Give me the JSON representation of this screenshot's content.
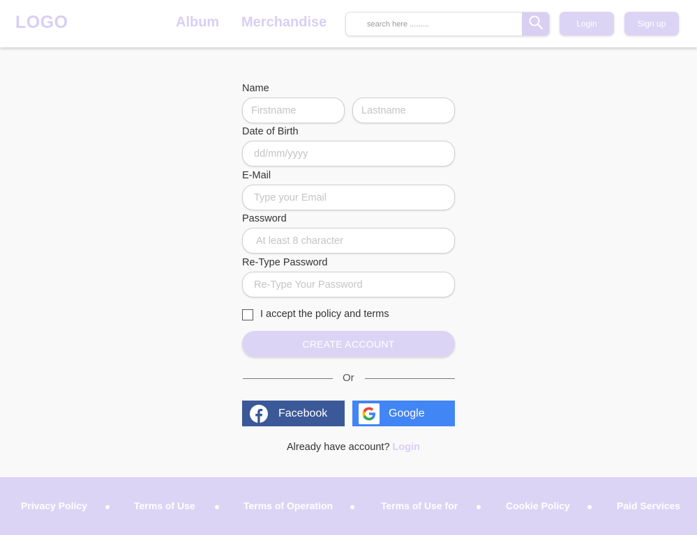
{
  "header": {
    "logo": "LOGO",
    "nav": [
      "Album",
      "Merchandise"
    ],
    "search_placeholder": "search here .........",
    "login_label": "Login",
    "signup_label": "Sign up"
  },
  "form": {
    "name_label": "Name",
    "firstname_placeholder": "Firstname",
    "lastname_placeholder": "Lastname",
    "dob_label": "Date of Birth",
    "dob_placeholder": "dd/mm/yyyy",
    "email_label": "E-Mail",
    "email_placeholder": "Type your Email",
    "password_label": "Password",
    "password_placeholder": "At least 8 character",
    "retype_label": "Re-Type Password",
    "retype_placeholder": "Re-Type Your Password",
    "accept_label": "I accept the policy and terms",
    "create_label": "CREATE ACCOUNT",
    "or_label": "Or",
    "facebook_label": "Facebook",
    "google_label": "Google",
    "already_text": "Already have account?",
    "already_link": "Login"
  },
  "footer": {
    "links": [
      "Privacy Policy",
      "Terms of Use",
      "Terms of Operation",
      "Terms of Use for",
      "Cookie Policy",
      "Paid Services"
    ]
  },
  "colors": {
    "accent": "#d8cff3",
    "facebook": "#3b5998",
    "google": "#4285f4"
  }
}
